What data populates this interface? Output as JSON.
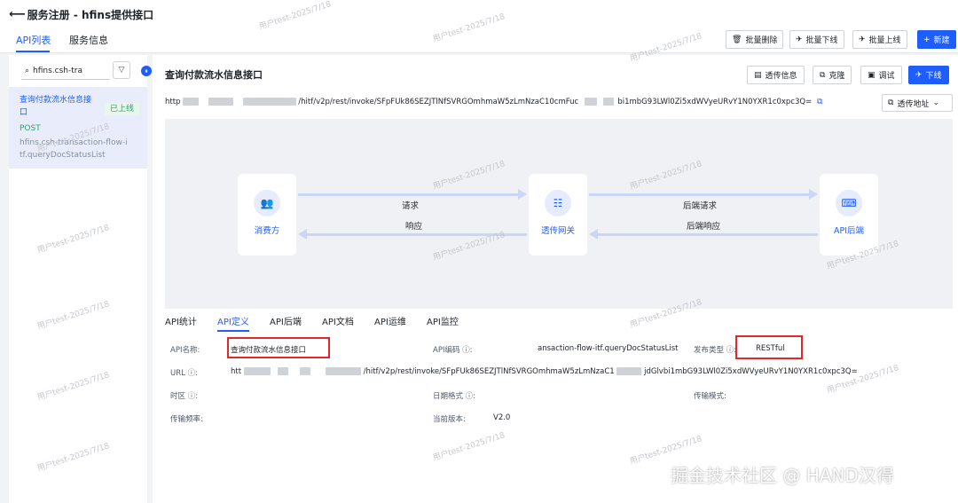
{
  "header": {
    "back_icon": "arrow-left-icon",
    "title": "服务注册 - hfins提供接口"
  },
  "tabs": {
    "api_list": "API列表",
    "service_info": "服务信息"
  },
  "toolbar": {
    "batch_delete": "批量删除",
    "batch_offline": "批量下线",
    "batch_online": "批量上线",
    "new": "新建"
  },
  "sidebar": {
    "search_value": "hfins.csh-tra",
    "api_item": {
      "name": "查询付款流水信息接口",
      "status": "已上线",
      "method": "POST",
      "path": "hfins.csh-transaction-flow-itf.queryDocStatusList"
    }
  },
  "main": {
    "title": "查询付款流水信息接口",
    "buttons": {
      "transparent_info": "透传信息",
      "clone": "克隆",
      "debug": "调试",
      "offline": "下线"
    },
    "url_prefix": "http",
    "url_mid": "/hitf/v2p/rest/invoke/SFpFUk86SEZJTlNfSVRGOmhmaW5zLmNzaC10cmFuc",
    "url_suffix": "bi1mbG93LWl0Zi5xdWVyeURvY1N0YXR1c0xpc3Q=",
    "transparent_addr": "透传地址"
  },
  "flow": {
    "consumer": "消费方",
    "gateway": "透传网关",
    "backend": "API后端",
    "request": "请求",
    "response": "响应",
    "backend_request": "后端请求",
    "backend_response": "后端响应"
  },
  "detail_tabs": [
    "API统计",
    "API定义",
    "API后端",
    "API文档",
    "API运维",
    "API监控"
  ],
  "definition": {
    "name_label": "API名称:",
    "name_value": "查询付款流水信息接口",
    "code_label": "API编码",
    "code_value": "ansaction-flow-itf.queryDocStatusList",
    "publish_label": "发布类型",
    "publish_value": "RESTful",
    "url_label": "URL",
    "url_prefix": "htt",
    "url_mid": "/hitf/v2p/rest/invoke/SFpFUk86SEZJTlNfSVRGOmhmaW5zLmNzaC1",
    "url_suffix": "jdGlvbi1mbG93LWl0Zi5xdWVyeURvY1N0YXR1c0xpc3Q=",
    "timezone_label": "时区",
    "date_format_label": "日期格式",
    "transfer_mode_label": "传输模式:",
    "frequency_label": "传输频率:",
    "version_label": "当前版本:",
    "version_value": "V2.0"
  },
  "watermark": "用户test-2025/7/18",
  "footer_mark": "掘金技术社区 @ HAND汉得",
  "colors": {
    "accent": "#1e5eff",
    "success": "#2ba471",
    "highlight": "#e0292b"
  }
}
